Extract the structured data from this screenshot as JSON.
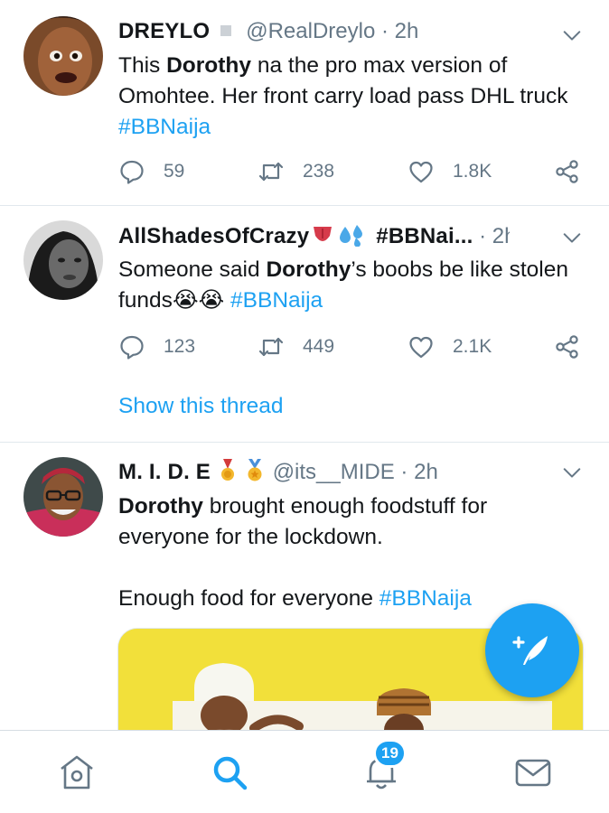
{
  "feed": {
    "tweets": [
      {
        "display_name": "DREYLO",
        "handle": "@RealDreylo",
        "separator": "·",
        "time": "2h",
        "text": {
          "p1": "This ",
          "b1": "Dorothy",
          "p2": " na the pro max version of Omohtee. Her front carry load pass DHL truck ",
          "hashtag": "#BBNaija"
        },
        "replies": "59",
        "retweets": "238",
        "likes": "1.8K"
      },
      {
        "display_name": "AllShadesOfCrazy",
        "name_suffix": "#BBNai...",
        "separator": "·",
        "time": "2h",
        "text": {
          "p1": "Someone said ",
          "b1": "Dorothy",
          "p2": "’s boobs be like stolen funds",
          "emoji": "😭😭",
          "hashtag": "#BBNaija"
        },
        "replies": "123",
        "retweets": "449",
        "likes": "2.1K",
        "show_thread": "Show this thread"
      },
      {
        "display_name": "M. I. D. E",
        "name_emoji": "🎖️🏅",
        "handle": "@its__MIDE",
        "separator": "·",
        "time": "2h",
        "text": {
          "b1": "Dorothy",
          "p1": " brought enough foodstuff for everyone for the lockdown.",
          "p2": "Enough food for everyone ",
          "hashtag": "#BBNaija"
        }
      }
    ]
  },
  "navbar": {
    "notification_count": "19",
    "active_tab": "search"
  },
  "colors": {
    "accent": "#1da1f2",
    "secondary_text": "#657786",
    "divider": "#e1e8ed"
  },
  "icons": [
    "reply-icon",
    "retweet-icon",
    "like-icon",
    "share-icon",
    "chevron-down-icon",
    "compose-icon",
    "home-icon",
    "search-icon",
    "bell-icon",
    "mail-icon"
  ]
}
